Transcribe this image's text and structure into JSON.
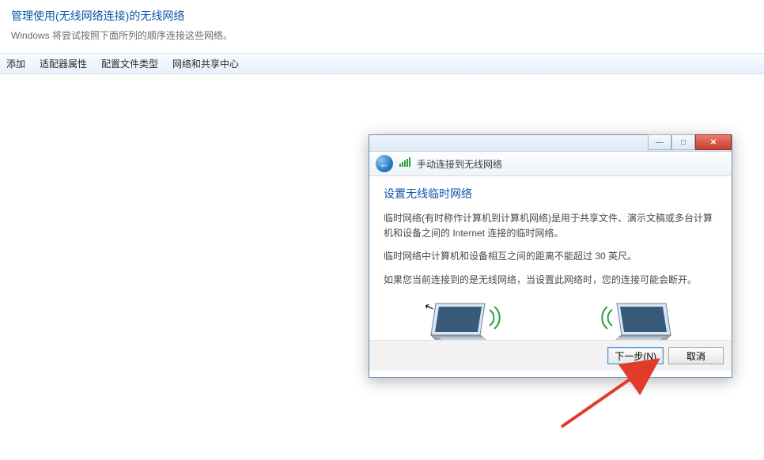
{
  "page": {
    "title": "管理使用(无线网络连接)的无线网络",
    "subtitle": "Windows 将尝试按照下面所列的顺序连接这些网络。",
    "toolbar": {
      "add": "添加",
      "adapter": "适配器属性",
      "profile": "配置文件类型",
      "center": "网络和共享中心"
    }
  },
  "dialog": {
    "titlebar": {
      "close_label": "✕",
      "minimize_label": "—",
      "maximize_label": "□"
    },
    "header": {
      "back_glyph": "←",
      "signal_glyph": "▮▮▮",
      "breadcrumb": "手动连接到无线网络"
    },
    "body": {
      "heading": "设置无线临时网络",
      "para1": "临时网络(有时称作计算机到计算机网络)是用于共享文件、演示文稿或多台计算机和设备之间的 Internet 连接的临时网络。",
      "para2": "临时网络中计算机和设备相互之间的距离不能超过 30 英尺。",
      "para3": "如果您当前连接到的是无线网络，当设置此网络时，您的连接可能会断开。"
    },
    "buttons": {
      "next": "下一步(N)",
      "cancel": "取消"
    }
  }
}
